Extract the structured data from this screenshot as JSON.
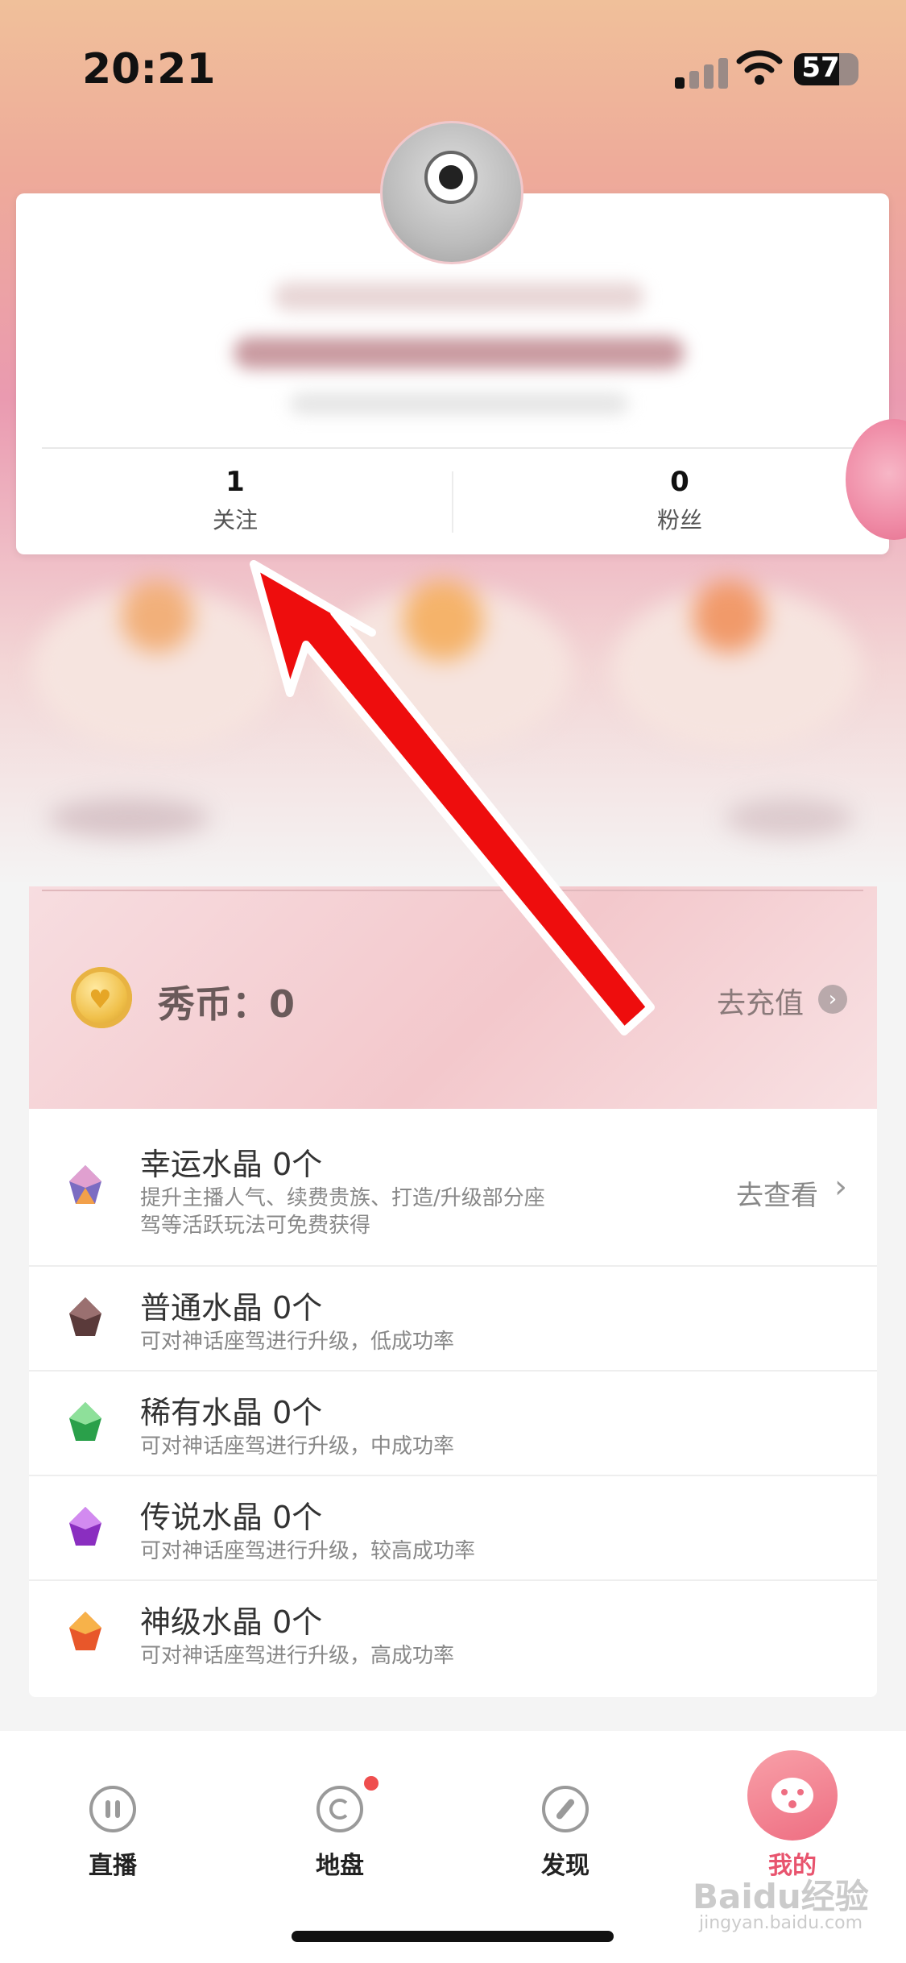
{
  "status_bar": {
    "time": "20:21",
    "battery": "57"
  },
  "profile": {
    "stats": [
      {
        "value": "1",
        "label": "关注"
      },
      {
        "value": "0",
        "label": "粉丝"
      }
    ]
  },
  "wallet": {
    "coin_label": "秀币：",
    "coin_value": "0",
    "recharge_label": "去充值"
  },
  "crystals": {
    "items": [
      {
        "name": "幸运水晶",
        "count": "0个",
        "desc": "提升主播人气、续费贵族、打造/升级部分座驾等活跃玩法可免费获得",
        "action": "去查看",
        "icon": "lucky-crystal-icon",
        "color": "#7b6cc2"
      },
      {
        "name": "普通水晶",
        "count": "0个",
        "desc": "可对神话座驾进行升级，低成功率",
        "icon": "common-crystal-icon",
        "color": "#5a3a3a"
      },
      {
        "name": "稀有水晶",
        "count": "0个",
        "desc": "可对神话座驾进行升级，中成功率",
        "icon": "rare-crystal-icon",
        "color": "#2aa04a"
      },
      {
        "name": "传说水晶",
        "count": "0个",
        "desc": "可对神话座驾进行升级，较高成功率",
        "icon": "legend-crystal-icon",
        "color": "#8a2ec0"
      },
      {
        "name": "神级水晶",
        "count": "0个",
        "desc": "可对神话座驾进行升级，高成功率",
        "icon": "divine-crystal-icon",
        "color": "#e8572a"
      }
    ]
  },
  "nav": {
    "items": [
      {
        "label": "直播",
        "icon": "live-icon"
      },
      {
        "label": "地盘",
        "icon": "territory-icon",
        "badge": true
      },
      {
        "label": "发现",
        "icon": "compass-icon"
      },
      {
        "label": "我的",
        "icon": "me-icon",
        "active": true,
        "active_color": "#e8546e"
      }
    ]
  },
  "watermark": {
    "main": "Baidu经验",
    "sub": "jingyan.baidu.com"
  }
}
